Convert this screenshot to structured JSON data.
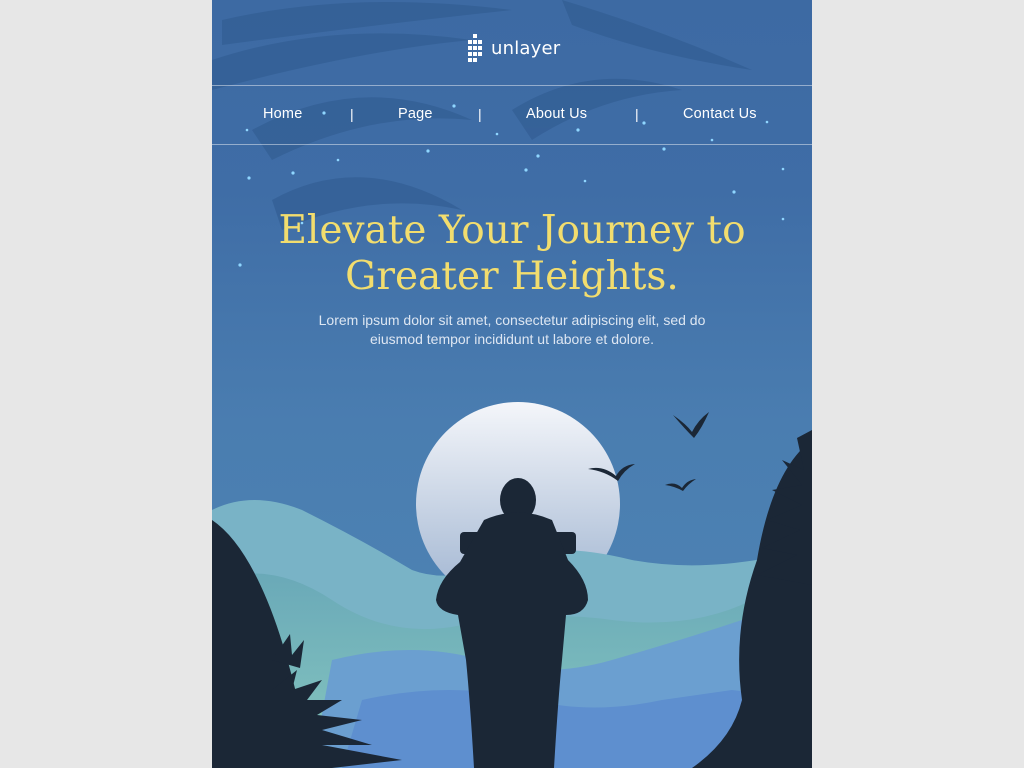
{
  "brand": {
    "logo_icon": "unlayer-grid-logo-icon",
    "name": "unlayer"
  },
  "nav": {
    "items": [
      {
        "label": "Home"
      },
      {
        "label": "Page"
      },
      {
        "label": "About Us"
      },
      {
        "label": "Contact Us"
      }
    ],
    "separator": "|"
  },
  "hero": {
    "title_line1": "Elevate Your Journey to",
    "title_line2": "Greater Heights.",
    "subtitle_line1": "Lorem ipsum dolor sit amet, consectetur adipiscing elit, sed do",
    "subtitle_line2": "eiusmod tempor incididunt ut labore et dolore."
  },
  "illustration": {
    "icon": "hiker-silhouette-moon-mountains-illustration",
    "colors": {
      "sky": "#4274aa",
      "moon": "#e2e8f1",
      "hills_light": "#7cc0bd",
      "hills_blue": "#6b9fd0",
      "silhouette": "#1b2736",
      "title": "#f2dd6e",
      "stars": "#8fd6ff"
    }
  }
}
